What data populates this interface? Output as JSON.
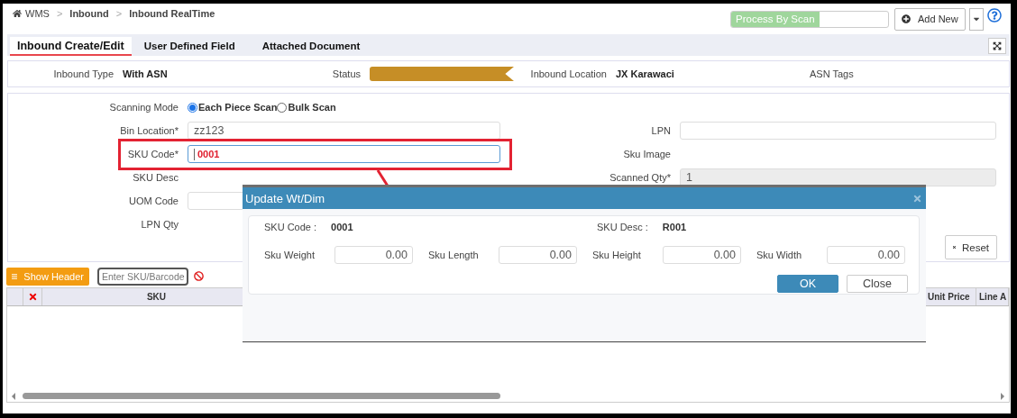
{
  "breadcrumb": [
    {
      "label": "WMS"
    },
    {
      "separator": ">",
      "label": "Inbound"
    },
    {
      "separator": ">",
      "label": "Inbound RealTime"
    }
  ],
  "toolbar": {
    "scan_label": "Process By Scan",
    "add_button": "Add New"
  },
  "tabs": [
    {
      "label": "Inbound Create/Edit",
      "selected": true
    },
    {
      "label": "User Defined Field",
      "selected": false
    },
    {
      "label": "Attached Document",
      "selected": false
    }
  ],
  "info": [
    {
      "kind": "text",
      "label": "Inbound Type",
      "value": "With ASN"
    },
    {
      "kind": "status",
      "label": "Status"
    },
    {
      "kind": "text",
      "label": "Inbound Location",
      "value": "JX Karawaci"
    },
    {
      "kind": "text",
      "label": "ASN Tags"
    }
  ],
  "form": {
    "left": [
      {
        "kind": "radio",
        "label": "Scanning Mode",
        "highlighted": false,
        "options": [
          {
            "label": "Each Piece Scan",
            "selected": true
          },
          {
            "label": "Bulk Scan",
            "selected": false
          }
        ]
      },
      {
        "kind": "input",
        "label": "Bin Location*",
        "value": "zz123",
        "highlighted": false
      },
      {
        "kind": "input",
        "label": "SKU Code*",
        "value": "0001",
        "highlighted": true
      },
      {
        "kind": "text",
        "label": "SKU Desc",
        "highlighted": false
      },
      {
        "kind": "input",
        "label": "UOM Code",
        "highlighted": false
      },
      {
        "kind": "text",
        "label": "LPN Qty",
        "highlighted": false
      }
    ],
    "right": [
      {
        "kind": "input",
        "label": "LPN"
      },
      {
        "kind": "text",
        "label": "Sku Image"
      },
      {
        "kind": "readonly",
        "label": "Scanned Qty*",
        "value": "1"
      }
    ],
    "reset_button": "Reset"
  },
  "grid": {
    "show_header_button": "Show Header",
    "search": {
      "placeholder": "Enter SKU/Barcode"
    },
    "columns": [
      "SKU",
      "Unit Price",
      "Line A"
    ]
  },
  "dialog": {
    "title": "Update Wt/Dim",
    "info": [
      {
        "label": "SKU Code :",
        "value": "0001"
      },
      {
        "label": "SKU Desc :",
        "value": "R001"
      }
    ],
    "fields": [
      {
        "label": "Sku Weight",
        "value": "0.00"
      },
      {
        "label": "Sku Length",
        "value": "0.00"
      },
      {
        "label": "Sku Height",
        "value": "0.00"
      },
      {
        "label": "Sku Width",
        "value": "0.00"
      }
    ],
    "buttons": [
      {
        "kind": "primary",
        "label": "OK"
      },
      {
        "kind": "secondary",
        "label": "Close"
      }
    ]
  }
}
